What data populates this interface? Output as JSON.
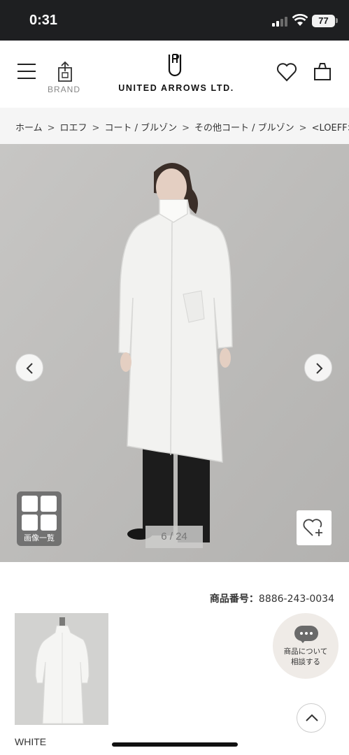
{
  "status_bar": {
    "time": "0:31",
    "battery": "77"
  },
  "header": {
    "brand_label": "BRAND",
    "logo_text": "UNITED ARROWS LTD."
  },
  "breadcrumb": [
    {
      "label": "ホーム"
    },
    {
      "label": "ロエフ"
    },
    {
      "label": "コート / ブルゾン"
    },
    {
      "label": "その他コート / ブルゾン"
    },
    {
      "label": "<LOEFF>"
    }
  ],
  "breadcrumb_separator": ">",
  "gallery": {
    "counter": "6 / 24",
    "thumb_list_label": "画像一覧"
  },
  "product": {
    "code_label": "商品番号：",
    "code_value": "8886-243-0034",
    "color_name": "WHITE"
  },
  "chat": {
    "line1": "商品について",
    "line2": "相談する"
  },
  "icons": {
    "menu": "hamburger-menu-icon",
    "brand": "shopping-tag-icon",
    "logo": "united-arrows-logo-icon",
    "favorite": "heart-icon",
    "cart": "shopping-bag-icon",
    "prev": "chevron-left-icon",
    "next": "chevron-right-icon",
    "grid": "grid-icon",
    "add_favorite": "heart-plus-icon",
    "chat": "chat-bubble-icon",
    "scroll_top": "chevron-up-icon"
  },
  "colors": {
    "status_bar_bg": "#1e1f21",
    "breadcrumb_bg": "#f5f5f5",
    "gallery_bg": "#bfbebc",
    "chat_bg": "#efebe7"
  }
}
